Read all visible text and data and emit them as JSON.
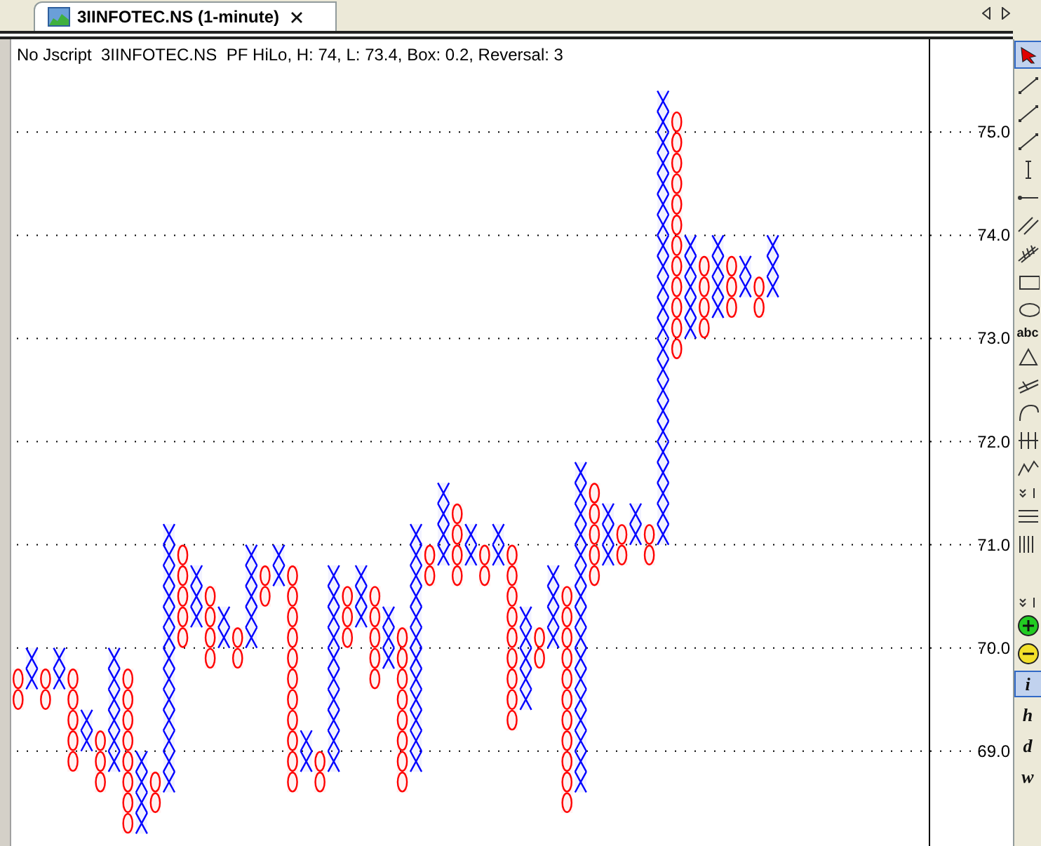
{
  "tab": {
    "title": "3IINFOTEC.NS (1-minute)",
    "selected": true
  },
  "chart": {
    "header": "No Jscript  3IINFOTEC.NS  PF HiLo, H: 74, L: 73.4, Box: 0.2, Reversal: 3",
    "chart_data": {
      "type": "candlestick",
      "grid": true,
      "ylim": [
        68.08,
        75.9
      ],
      "categories": [
        null,
        null,
        null,
        null,
        null,
        null,
        null,
        null,
        null,
        null,
        null,
        null,
        null,
        null,
        null,
        null,
        null,
        null,
        null,
        null,
        null,
        null,
        null,
        null,
        null,
        null,
        null,
        null,
        null,
        null,
        null,
        null,
        null,
        null,
        null,
        null,
        null,
        null,
        null,
        null,
        null,
        null,
        null,
        null,
        null,
        null,
        null,
        null,
        null,
        null,
        null,
        null,
        null,
        null,
        null,
        null,
        null,
        null,
        null,
        null,
        null,
        null,
        null,
        null,
        null,
        null,
        null,
        null,
        null,
        null,
        null,
        null,
        null
      ],
      "yticks": [
        {
          "value": 75,
          "label": "75.0"
        },
        {
          "value": 74,
          "label": "74.0"
        },
        {
          "value": 73,
          "label": "73.0"
        },
        {
          "value": 72,
          "label": "72.0"
        },
        {
          "value": 71,
          "label": "71.0"
        },
        {
          "value": 70,
          "label": "70.0"
        },
        {
          "value": 69,
          "label": "69.0"
        }
      ],
      "ohlc": [
        [
          69.8,
          69.8,
          69.4,
          69.4
        ],
        [
          69.6,
          70.0,
          69.6,
          70.0
        ],
        [
          69.8,
          69.8,
          69.4,
          69.4
        ],
        [
          69.6,
          70.0,
          69.6,
          70.0
        ],
        [
          69.8,
          69.8,
          68.8,
          68.8
        ],
        [
          69.0,
          69.4,
          69.0,
          69.4
        ],
        [
          69.2,
          69.2,
          68.6,
          68.6
        ],
        [
          68.8,
          70.0,
          68.8,
          70.0
        ],
        [
          69.8,
          69.8,
          68.2,
          68.2
        ],
        [
          68.2,
          69.0,
          68.2,
          69.0
        ],
        [
          68.8,
          68.8,
          68.4,
          68.4
        ],
        [
          68.6,
          71.2,
          68.6,
          71.2
        ],
        [
          71.0,
          71.0,
          70.0,
          70.0
        ],
        [
          70.2,
          70.8,
          70.2,
          70.8
        ],
        [
          70.6,
          70.6,
          69.8,
          69.8
        ],
        [
          70.0,
          70.4,
          70.0,
          70.4
        ],
        [
          70.2,
          70.2,
          69.8,
          69.8
        ],
        [
          70.0,
          71.0,
          70.0,
          71.0
        ],
        [
          70.8,
          70.8,
          70.4,
          70.4
        ],
        [
          70.6,
          71.0,
          70.6,
          71.0
        ],
        [
          70.8,
          70.8,
          68.6,
          68.6
        ],
        [
          68.8,
          69.2,
          68.8,
          69.2
        ],
        [
          69.0,
          69.0,
          68.6,
          68.6
        ],
        [
          68.8,
          70.8,
          68.8,
          70.8
        ],
        [
          70.6,
          70.6,
          70.0,
          70.0
        ],
        [
          70.2,
          70.8,
          70.2,
          70.8
        ],
        [
          70.6,
          70.6,
          69.6,
          69.6
        ],
        [
          69.8,
          70.4,
          69.8,
          70.4
        ],
        [
          70.2,
          70.2,
          68.6,
          68.6
        ],
        [
          68.8,
          71.2,
          68.8,
          71.2
        ],
        [
          71.0,
          71.0,
          70.6,
          70.6
        ],
        [
          70.8,
          71.6,
          70.8,
          71.6
        ],
        [
          71.4,
          71.4,
          70.6,
          70.6
        ],
        [
          70.8,
          71.2,
          70.8,
          71.2
        ],
        [
          71.0,
          71.0,
          70.6,
          70.6
        ],
        [
          70.8,
          71.2,
          70.8,
          71.2
        ],
        [
          71.0,
          71.0,
          69.2,
          69.2
        ],
        [
          69.4,
          70.4,
          69.4,
          70.4
        ],
        [
          70.2,
          70.2,
          69.8,
          69.8
        ],
        [
          70.0,
          70.8,
          70.0,
          70.8
        ],
        [
          70.6,
          70.6,
          68.4,
          68.4
        ],
        [
          68.6,
          71.8,
          68.6,
          71.8
        ],
        [
          71.6,
          71.6,
          70.6,
          70.6
        ],
        [
          70.8,
          71.4,
          70.8,
          71.4
        ],
        [
          71.2,
          71.2,
          70.8,
          70.8
        ],
        [
          71.0,
          71.4,
          71.0,
          71.4
        ],
        [
          71.2,
          71.2,
          70.8,
          70.8
        ],
        [
          71.0,
          75.4,
          71.0,
          75.4
        ],
        [
          75.2,
          75.2,
          72.8,
          72.8
        ],
        [
          73.0,
          74.0,
          73.0,
          74.0
        ],
        [
          73.8,
          73.8,
          73.0,
          73.0
        ],
        [
          73.2,
          74.0,
          73.2,
          74.0
        ],
        [
          73.8,
          73.8,
          73.2,
          73.2
        ],
        [
          73.4,
          73.8,
          73.4,
          73.8
        ],
        [
          73.6,
          73.6,
          73.2,
          73.2
        ],
        [
          73.4,
          74.0,
          73.4,
          74.0
        ],
        null,
        null,
        null,
        null,
        null,
        null,
        null,
        null,
        null,
        null,
        null,
        null,
        null,
        null,
        null,
        null,
        null
      ]
    }
  },
  "toolbar": {
    "text_tool": "abc",
    "letter_tools": [
      {
        "label": "i",
        "selected": true
      },
      {
        "label": "h",
        "selected": false
      },
      {
        "label": "d",
        "selected": false
      },
      {
        "label": "w",
        "selected": false
      }
    ]
  }
}
